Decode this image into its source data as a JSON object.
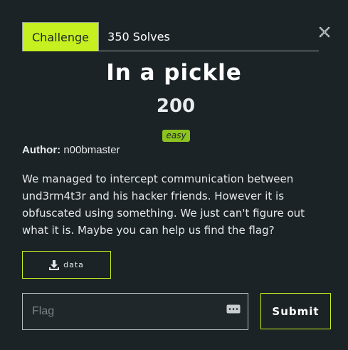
{
  "tabs": {
    "challenge_label": "Challenge",
    "solves_label": "350 Solves"
  },
  "challenge": {
    "name": "In a pickle",
    "points": "200",
    "difficulty": "easy",
    "author_label": "Author:",
    "author": "n00bmaster",
    "description": "We managed to intercept communication between und3rm4t3r and his hacker friends. However it is obfuscated using something. We just can't figure out what it is. Maybe you can help us find the flag?"
  },
  "files": [
    {
      "label": "data",
      "icon": "download-icon"
    }
  ],
  "flag_form": {
    "placeholder": "Flag",
    "value": "",
    "password_icon": "password-manager-icon",
    "submit_label": "Submit"
  },
  "modal": {
    "close_icon": "close-icon"
  },
  "colors": {
    "background": "#1c2327",
    "accent": "#c6f01f",
    "badge": "#8bc31f",
    "text": "#e6e8e9"
  }
}
